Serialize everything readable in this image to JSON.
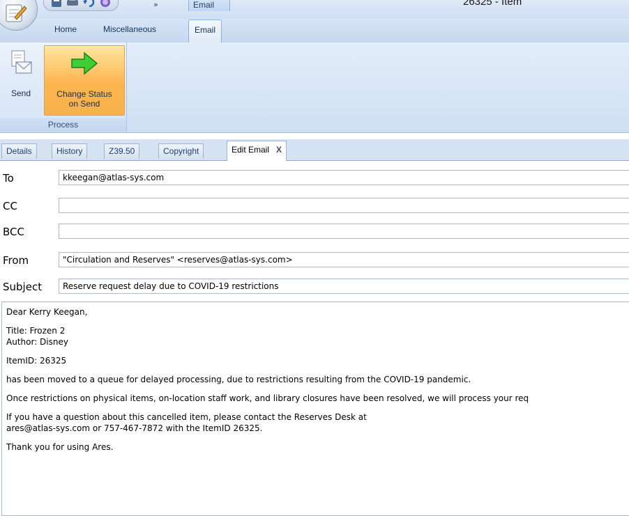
{
  "window": {
    "title": "26325 - Item",
    "context_tab_title": "Email"
  },
  "quick_access": {
    "icons": [
      "save-icon",
      "print-icon",
      "undo-icon",
      "help-icon"
    ],
    "more_label": "»"
  },
  "ribbon_tabs": [
    {
      "label": "Home",
      "active": false
    },
    {
      "label": "Miscellaneous",
      "active": false
    },
    {
      "label": "Email",
      "active": true
    }
  ],
  "ribbon": {
    "groups": [
      {
        "label": "Process",
        "buttons": [
          {
            "label": "Send",
            "icon": "send-mail-icon"
          },
          {
            "label": "Change Status on Send",
            "line1": "Change Status",
            "line2": "on Send",
            "icon": "green-arrow-icon",
            "selected": true
          }
        ]
      }
    ]
  },
  "doc_tabs": [
    {
      "label": "Details"
    },
    {
      "label": "History"
    },
    {
      "label": "Z39.50"
    },
    {
      "label": "Copyright"
    },
    {
      "label": "Edit Email",
      "active": true,
      "close": "X"
    }
  ],
  "form": {
    "to_label": "To",
    "to_value": "kkeegan@atlas-sys.com",
    "cc_label": "CC",
    "cc_value": "",
    "bcc_label": "BCC",
    "bcc_value": "",
    "from_label": "From",
    "from_value": "\"Circulation and Reserves\" <reserves@atlas-sys.com>",
    "subject_label": "Subject",
    "subject_value": "Reserve request delay due to COVID-19 restrictions"
  },
  "body": {
    "greeting": "Dear Kerry Keegan,",
    "title_line": "Title: Frozen 2",
    "author_line": "Author: Disney",
    "item_line": "ItemID: 26325",
    "para1": "has been moved to a queue for delayed processing, due to restrictions resulting from the COVID-19 pandemic.",
    "para2": "Once restrictions on physical items, on-location staff work, and library closures have been resolved, we will process your req",
    "para3_line1": "If you have a question about this cancelled item, please contact the Reserves Desk at",
    "para3_line2": "ares@atlas-sys.com or 757-467-7872 with the ItemID 26325.",
    "closing": "Thank you for using Ares."
  }
}
